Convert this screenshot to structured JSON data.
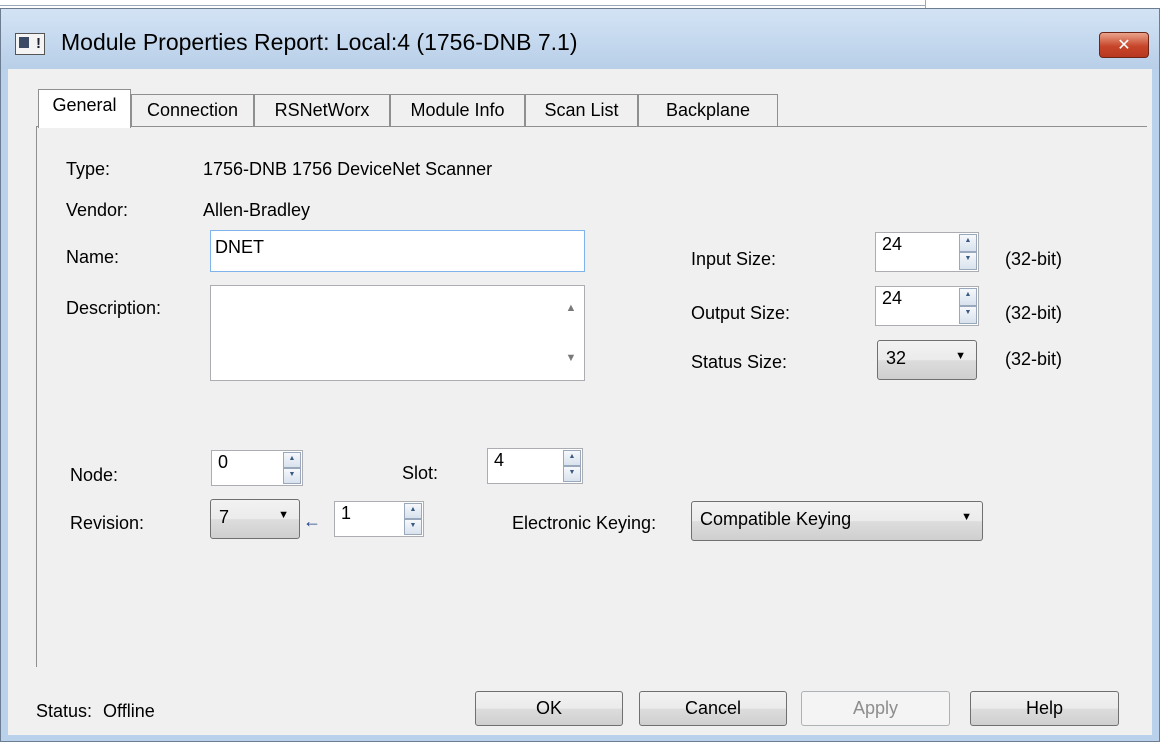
{
  "window": {
    "title": "Module Properties Report: Local:4 (1756-DNB 7.1)",
    "close_glyph": "✕"
  },
  "tabs": [
    {
      "label": "General",
      "active": true
    },
    {
      "label": "Connection",
      "active": false
    },
    {
      "label": "RSNetWorx",
      "active": false
    },
    {
      "label": "Module Info",
      "active": false
    },
    {
      "label": "Scan List",
      "active": false
    },
    {
      "label": "Backplane",
      "active": false
    }
  ],
  "general": {
    "type_label": "Type:",
    "type_value": "1756-DNB 1756 DeviceNet Scanner",
    "vendor_label": "Vendor:",
    "vendor_value": "Allen-Bradley",
    "name_label": "Name:",
    "name_value": "DNET",
    "description_label": "Description:",
    "description_value": "",
    "input_size_label": "Input Size:",
    "input_size_value": "24",
    "output_size_label": "Output Size:",
    "output_size_value": "24",
    "status_size_label": "Status Size:",
    "status_size_value": "32",
    "size_unit": "(32-bit)",
    "node_label": "Node:",
    "node_value": "0",
    "slot_label": "Slot:",
    "slot_value": "4",
    "revision_label": "Revision:",
    "revision_major": "7",
    "revision_minor": "1",
    "keying_label": "Electronic Keying:",
    "keying_value": "Compatible Keying"
  },
  "footer": {
    "status_label": "Status:",
    "status_value": "Offline",
    "ok_label": "OK",
    "cancel_label": "Cancel",
    "apply_label": "Apply",
    "help_label": "Help"
  },
  "icons": {
    "app_icon": "module-window-icon",
    "close_icon": "close-icon",
    "spin_up": "▲",
    "spin_down": "▼",
    "dropdown": "▼",
    "revision_arrow": "←"
  }
}
